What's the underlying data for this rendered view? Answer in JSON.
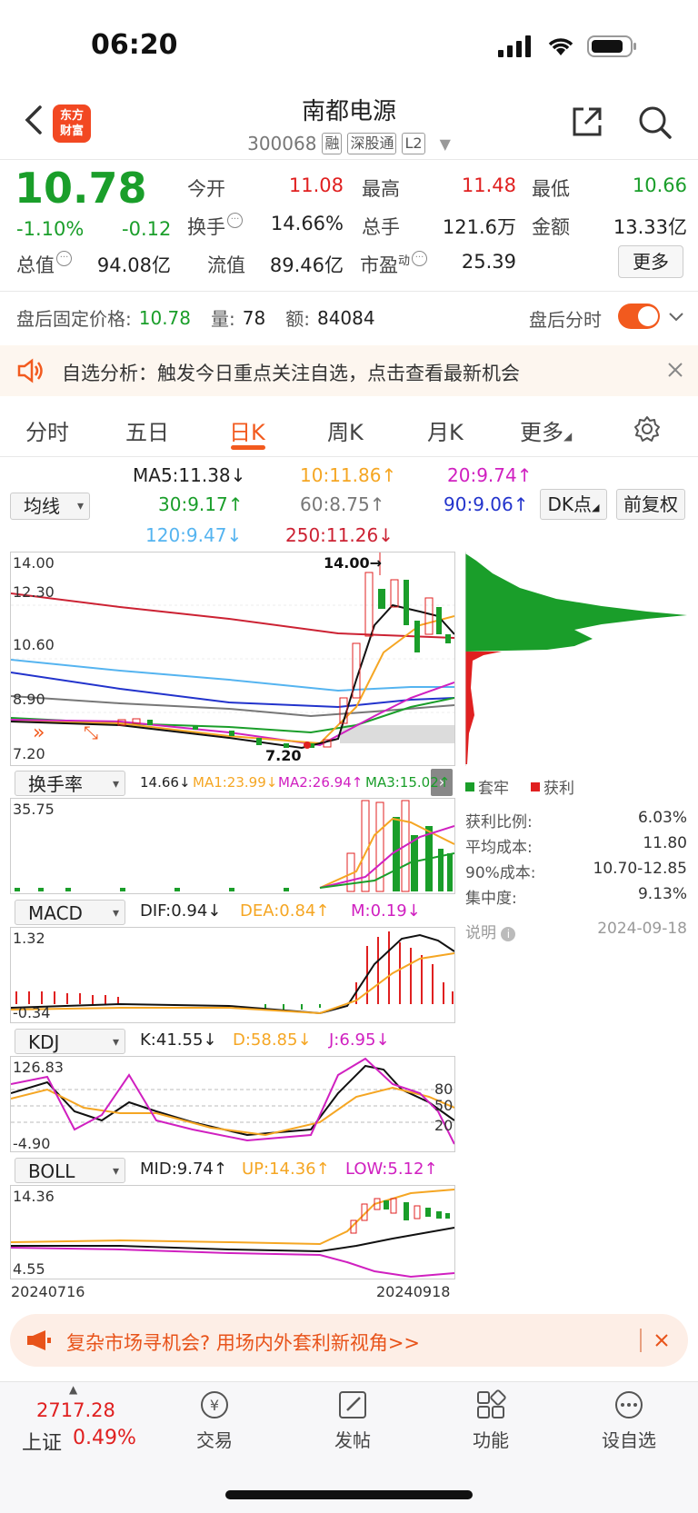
{
  "status": {
    "time": "06:20"
  },
  "header": {
    "logo_text_1": "东方",
    "logo_text_2": "财富",
    "stock_name": "南都电源",
    "stock_code": "300068",
    "tag_margin": "融",
    "tag_connect": "深股通",
    "tag_level": "L2"
  },
  "quote": {
    "price": "10.78",
    "change_pct": "-1.10%",
    "change_val": "-0.12",
    "open_label": "今开",
    "open": "11.08",
    "high_label": "最高",
    "high": "11.48",
    "low_label": "最低",
    "low": "10.66",
    "turnover_label": "换手",
    "turnover": "14.66%",
    "volume_label": "总手",
    "volume": "121.6万",
    "amount_label": "金额",
    "amount": "13.33亿",
    "mktcap_label": "总值",
    "mktcap": "94.08亿",
    "float_label": "流值",
    "float_cap": "89.46亿",
    "pe_label": "市盈",
    "pe_sup": "动",
    "pe": "25.39",
    "more_label": "更多"
  },
  "afterhours": {
    "price_label": "盘后固定价格:",
    "price": "10.78",
    "qty_label": "量:",
    "qty": "78",
    "amt_label": "额:",
    "amt": "84084",
    "minute_label": "盘后分时"
  },
  "banner1": {
    "text": "自选分析：触发今日重点关注自选，点击查看最新机会"
  },
  "tabs": [
    "分时",
    "五日",
    "日K",
    "周K",
    "月K",
    "更多"
  ],
  "ma_legend": {
    "ma5": "MA5:11.38↓",
    "ma10": "10:11.86↑",
    "ma20": "20:9.74↑",
    "ma30": "30:9.17↑",
    "ma60": "60:8.75↑",
    "ma90": "90:9.06↑",
    "ma120": "120:9.47↓",
    "ma250": "250:11.26↓",
    "dropdown": "均线",
    "dk_button": "DK点",
    "adjust_button": "前复权"
  },
  "kline": {
    "axis": [
      "14.00",
      "12.30",
      "10.60",
      "8.90",
      "7.20"
    ],
    "high_mark": "14.00→",
    "low_mark": "7.20",
    "colors": {
      "up": "#e02020",
      "down": "#1a9e2a"
    }
  },
  "turnover": {
    "dropdown": "换手率",
    "value": "14.66↓",
    "ma1": "MA1:23.99↓",
    "ma2": "MA2:26.94↑",
    "ma3": "MA3:15.02↑",
    "axis_top": "35.75"
  },
  "macd": {
    "dropdown": "MACD",
    "dif": "DIF:0.94↓",
    "dea": "DEA:0.84↑",
    "m": "M:0.19↓",
    "axis_top": "1.32",
    "axis_bottom": "-0.34"
  },
  "kdj": {
    "dropdown": "KDJ",
    "k": "K:41.55↓",
    "d": "D:58.85↓",
    "j": "J:6.95↓",
    "axis_top": "126.83",
    "axis_bottom": "-4.90",
    "levels": [
      "80",
      "50",
      "20"
    ]
  },
  "boll": {
    "dropdown": "BOLL",
    "mid": "MID:9.74↑",
    "up": "UP:14.36↑",
    "low": "LOW:5.12↑",
    "axis_top": "14.36",
    "axis_bottom": "4.55"
  },
  "dates": {
    "start": "20240716",
    "end": "20240918"
  },
  "chips": {
    "legend_trapped": "套牢",
    "legend_profit": "获利",
    "rows": [
      {
        "label": "获利比例:",
        "value": "6.03%"
      },
      {
        "label": "平均成本:",
        "value": "11.80"
      },
      {
        "label": "90%成本:",
        "value": "10.70-12.85"
      },
      {
        "label": "集中度:",
        "value": "9.13%"
      }
    ],
    "note_label": "说明",
    "date": "2024-09-18"
  },
  "banner2": {
    "text": "复杂市场寻机会? 用场内外套利新视角>>"
  },
  "bottom_nav": {
    "index_value": "2717.28",
    "index_name": "上证",
    "index_pct": "0.49%",
    "trade": "交易",
    "post": "发帖",
    "features": "功能",
    "watchlist": "设自选"
  }
}
